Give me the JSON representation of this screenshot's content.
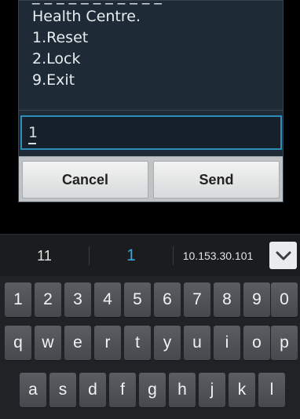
{
  "dialog": {
    "message_lines": [
      "Health Centre.",
      "1.Reset",
      "2.Lock",
      "9.Exit"
    ],
    "input_value": "1",
    "cancel_label": "Cancel",
    "send_label": "Send"
  },
  "suggestions": [
    "11",
    "1",
    "10.153.30.101"
  ],
  "icons": {
    "collapse": "chevron-down-icon"
  },
  "keyboard": {
    "row1": [
      "1",
      "2",
      "3",
      "4",
      "5",
      "6",
      "7",
      "8",
      "9",
      "0"
    ],
    "row2": [
      "q",
      "w",
      "e",
      "r",
      "t",
      "y",
      "u",
      "i",
      "o",
      "p"
    ],
    "row3": [
      "a",
      "s",
      "d",
      "f",
      "g",
      "h",
      "j",
      "k",
      "l"
    ]
  },
  "colors": {
    "accent": "#36a6e0",
    "dialog_bg": "#1e2b37",
    "input_border": "#2d8fb8"
  }
}
